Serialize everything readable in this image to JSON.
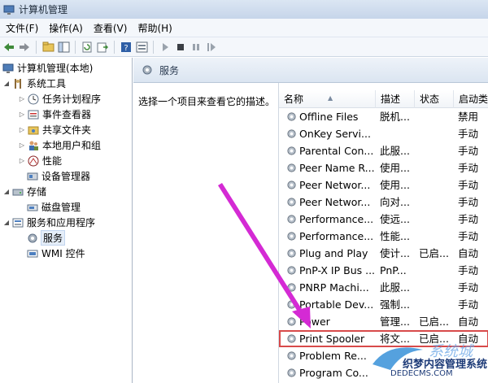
{
  "window": {
    "title": "计算机管理"
  },
  "menu": [
    "文件(F)",
    "操作(A)",
    "查看(V)",
    "帮助(H)"
  ],
  "tree": {
    "root": "计算机管理(本地)",
    "items": [
      {
        "label": "系统工具",
        "level": 1,
        "expanded": true,
        "icon": "tools-icon"
      },
      {
        "label": "任务计划程序",
        "level": 2,
        "icon": "clock-icon"
      },
      {
        "label": "事件查看器",
        "level": 2,
        "icon": "event-viewer-icon"
      },
      {
        "label": "共享文件夹",
        "level": 2,
        "icon": "shared-folder-icon"
      },
      {
        "label": "本地用户和组",
        "level": 2,
        "icon": "users-icon"
      },
      {
        "label": "性能",
        "level": 2,
        "icon": "performance-icon"
      },
      {
        "label": "设备管理器",
        "level": 2,
        "icon": "device-manager-icon"
      },
      {
        "label": "存储",
        "level": 1,
        "expanded": true,
        "icon": "storage-icon"
      },
      {
        "label": "磁盘管理",
        "level": 2,
        "icon": "disk-icon"
      },
      {
        "label": "服务和应用程序",
        "level": 1,
        "expanded": true,
        "icon": "services-apps-icon"
      },
      {
        "label": "服务",
        "level": 2,
        "icon": "services-icon",
        "selected": true
      },
      {
        "label": "WMI 控件",
        "level": 2,
        "icon": "wmi-icon"
      }
    ]
  },
  "pane_header": {
    "title": "服务"
  },
  "description": {
    "text": "选择一个项目来查看它的描述。"
  },
  "columns": {
    "name": "名称",
    "desc": "描述",
    "status": "状态",
    "startup": "启动类"
  },
  "services": [
    {
      "name": "Offline Files",
      "desc": "脱机...",
      "status": "",
      "startup": "禁用"
    },
    {
      "name": "OnKey Servi...",
      "desc": "",
      "status": "",
      "startup": "手动"
    },
    {
      "name": "Parental Con...",
      "desc": "此服...",
      "status": "",
      "startup": "手动"
    },
    {
      "name": "Peer Name R...",
      "desc": "使用...",
      "status": "",
      "startup": "手动"
    },
    {
      "name": "Peer Networ...",
      "desc": "使用...",
      "status": "",
      "startup": "手动"
    },
    {
      "name": "Peer Networ...",
      "desc": "向对...",
      "status": "",
      "startup": "手动"
    },
    {
      "name": "Performance...",
      "desc": "使远...",
      "status": "",
      "startup": "手动"
    },
    {
      "name": "Performance...",
      "desc": "性能...",
      "status": "",
      "startup": "手动"
    },
    {
      "name": "Plug and Play",
      "desc": "使计...",
      "status": "已启...",
      "startup": "自动"
    },
    {
      "name": "PnP-X IP Bus ...",
      "desc": "PnP...",
      "status": "",
      "startup": "手动"
    },
    {
      "name": "PNRP Machi...",
      "desc": "此服...",
      "status": "",
      "startup": "手动"
    },
    {
      "name": "Portable Dev...",
      "desc": "强制...",
      "status": "",
      "startup": "手动"
    },
    {
      "name": "Power",
      "desc": "管理...",
      "status": "已启...",
      "startup": "自动"
    },
    {
      "name": "Print Spooler",
      "desc": "将文...",
      "status": "已启...",
      "startup": "自动",
      "highlight": true
    },
    {
      "name": "Problem Re...",
      "desc": "",
      "status": "",
      "startup": ""
    },
    {
      "name": "Program Co...",
      "desc": "",
      "status": "",
      "startup": ""
    }
  ],
  "watermark": {
    "line1": "织梦内容管理系统",
    "line2": "DEDECMS.COM",
    "logo": "系统城"
  },
  "colors": {
    "arrow": "#d42ad4",
    "highlight": "#d84a4a",
    "selection": "#e5eef9"
  }
}
